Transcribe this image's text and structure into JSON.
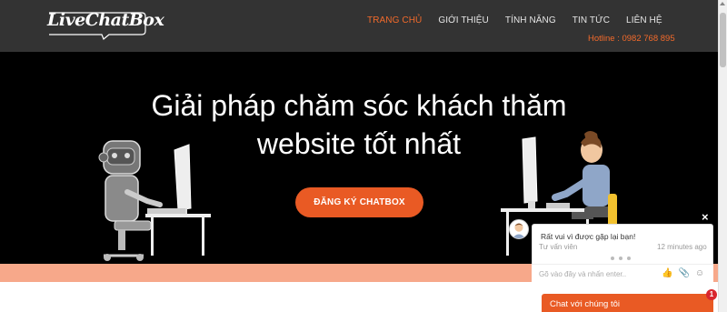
{
  "header": {
    "logo_text": "LiveChatBox",
    "nav": [
      {
        "label": "TRANG CHỦ",
        "active": true
      },
      {
        "label": "GIỚI THIỆU",
        "active": false
      },
      {
        "label": "TÍNH NĂNG",
        "active": false
      },
      {
        "label": "TIN TỨC",
        "active": false
      },
      {
        "label": "LIÊN HỆ",
        "active": false
      }
    ],
    "hotline": "Hotline : 0982 768 895"
  },
  "hero": {
    "title_line1": "Giải pháp chăm sóc khách thăm",
    "title_line2": "website tốt nhất",
    "cta_label": "ĐĂNG KÝ CHATBOX"
  },
  "chat": {
    "close": "×",
    "message": "Rất vui vì được gặp lại bạn!",
    "sender": "Tư vấn viên",
    "time": "12 minutes ago",
    "input_placeholder": "Gõ vào đây và nhấn enter..",
    "bar_label": "Chat với chúng tôi",
    "badge_count": "1"
  },
  "colors": {
    "accent": "#e95a24",
    "header_bg": "#333333",
    "hero_bg": "#000000",
    "band": "#f7a88a"
  },
  "icons": [
    "logo-icon",
    "thumbs-up-icon",
    "paperclip-icon",
    "smiley-icon",
    "close-icon"
  ]
}
